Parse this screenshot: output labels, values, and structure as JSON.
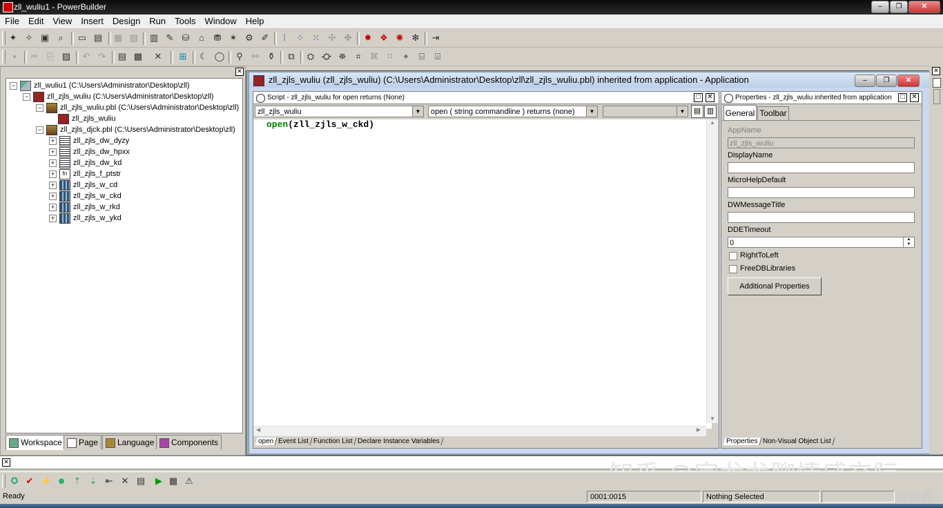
{
  "window": {
    "title": "zll_wuliu1 - PowerBuilder"
  },
  "menu": [
    "File",
    "Edit",
    "View",
    "Insert",
    "Design",
    "Run",
    "Tools",
    "Window",
    "Help"
  ],
  "tree": {
    "items": [
      "zll_wuliu1 (C:\\Users\\Administrator\\Desktop\\zll)",
      "zll_zjls_wuliu (C:\\Users\\Administrator\\Desktop\\zll)",
      "zll_zjls_wuliu.pbl (C:\\Users\\Administrator\\Desktop\\zll)",
      "zll_zjls_wuliu",
      "zll_zjls_djck.pbl (C:\\Users\\Administrator\\Desktop\\zll)",
      "zll_zjls_dw_dyzy",
      "zll_zjls_dw_hpxx",
      "zll_zjls_dw_kd",
      "zll_zjls_f_ptstr",
      "zll_zjls_w_cd",
      "zll_zjls_w_ckd",
      "zll_zjls_w_rkd",
      "zll_zjls_w_ykd"
    ],
    "tabs": [
      "Workspace",
      "Page",
      "Language",
      "Components"
    ]
  },
  "app_window": {
    "title": "zll_zjls_wuliu (zll_zjls_wuliu) (C:\\Users\\Administrator\\Desktop\\zll\\zll_zjls_wuliu.pbl) inherited from application - Application"
  },
  "script": {
    "header": "Script - zll_zjls_wuliu for open returns (None)",
    "object_dropdown": "zll_zjls_wuliu",
    "event_dropdown": "open ( string commandline ) returns (none)",
    "code_keyword": "open",
    "code_rest": "(zll_zjls_w_ckd)",
    "tabs": [
      "open",
      "Event List",
      "Function List",
      "Declare Instance Variables"
    ]
  },
  "properties": {
    "header": "Properties - zll_zjls_wuliu inherited from application",
    "tabs": [
      "General",
      "Toolbar"
    ],
    "appname_label": "AppName",
    "appname_value": "zll_zjls_wuliu",
    "displayname_label": "DisplayName",
    "displayname_value": "",
    "microhelp_label": "MicroHelpDefault",
    "microhelp_value": "",
    "dwmessage_label": "DWMessageTitle",
    "dwmessage_value": "",
    "ddetimeout_label": "DDETimeout",
    "ddetimeout_value": "0",
    "righttoleft_label": "RightToLeft",
    "freedb_label": "FreeDBLibraries",
    "additional_button": "Additional Properties",
    "bottom_tabs": [
      "Properties",
      "Non-Visual Object List"
    ]
  },
  "status": {
    "ready": "Ready",
    "position": "0001:0015",
    "selection": "Nothing Selected"
  },
  "watermark": "知乎 @宗龙龙聊情感交际",
  "corner_mark": "元计算"
}
